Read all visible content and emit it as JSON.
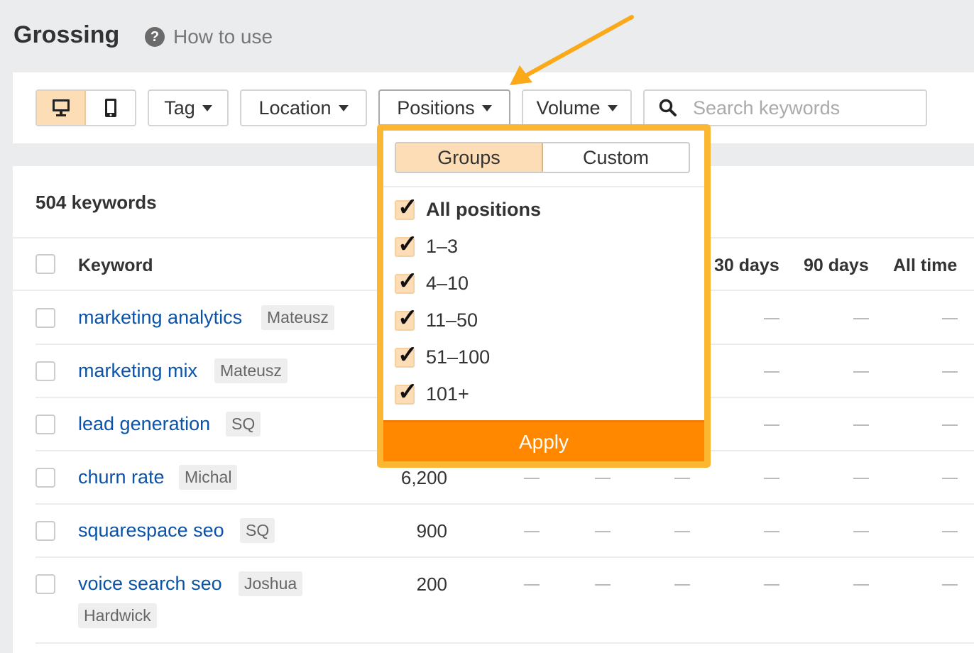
{
  "header": {
    "title": "Grossing",
    "help_label": "How to use"
  },
  "toolbar": {
    "tag": "Tag",
    "location": "Location",
    "positions": "Positions",
    "volume": "Volume",
    "search_placeholder": "Search keywords"
  },
  "summary": {
    "count": "504 keywords"
  },
  "table": {
    "headers": {
      "keyword": "Keyword",
      "d30": "30 days",
      "d90": "90 days",
      "all": "All time"
    },
    "rows": [
      {
        "keyword": "marketing analytics",
        "tag": "Mateusz",
        "volume": "",
        "cells": [
          "—",
          "—",
          "—",
          "—",
          "—",
          "—"
        ]
      },
      {
        "keyword": "marketing mix",
        "tag": "Mateusz",
        "volume": "",
        "cells": [
          "—",
          "—",
          "—",
          "—",
          "—",
          "—"
        ]
      },
      {
        "keyword": "lead generation",
        "tag": "SQ",
        "volume": "",
        "cells": [
          "—",
          "—",
          "—",
          "—",
          "—",
          "—"
        ]
      },
      {
        "keyword": "churn rate",
        "tag": "Michal",
        "volume": "6,200",
        "cells": [
          "—",
          "—",
          "—",
          "—",
          "—",
          "—"
        ]
      },
      {
        "keyword": "squarespace seo",
        "tag": "SQ",
        "volume": "900",
        "cells": [
          "—",
          "—",
          "—",
          "—",
          "—",
          "—"
        ]
      },
      {
        "keyword": "voice search seo",
        "tag": "Joshua",
        "tag2": "Hardwick",
        "volume": "200",
        "cells": [
          "—",
          "—",
          "—",
          "—",
          "—",
          "—"
        ]
      }
    ]
  },
  "dropdown": {
    "tabs": [
      "Groups",
      "Custom"
    ],
    "active_tab": "Groups",
    "options": [
      {
        "label": "All positions",
        "checked": true
      },
      {
        "label": "1–3",
        "checked": true
      },
      {
        "label": "4–10",
        "checked": true
      },
      {
        "label": "11–50",
        "checked": true
      },
      {
        "label": "51–100",
        "checked": true
      },
      {
        "label": "101+",
        "checked": true
      }
    ],
    "apply": "Apply"
  },
  "colors": {
    "accent": "#ff8800",
    "highlight": "#fbb731",
    "active_bg": "#fdddb6",
    "link": "#0b53a8"
  }
}
